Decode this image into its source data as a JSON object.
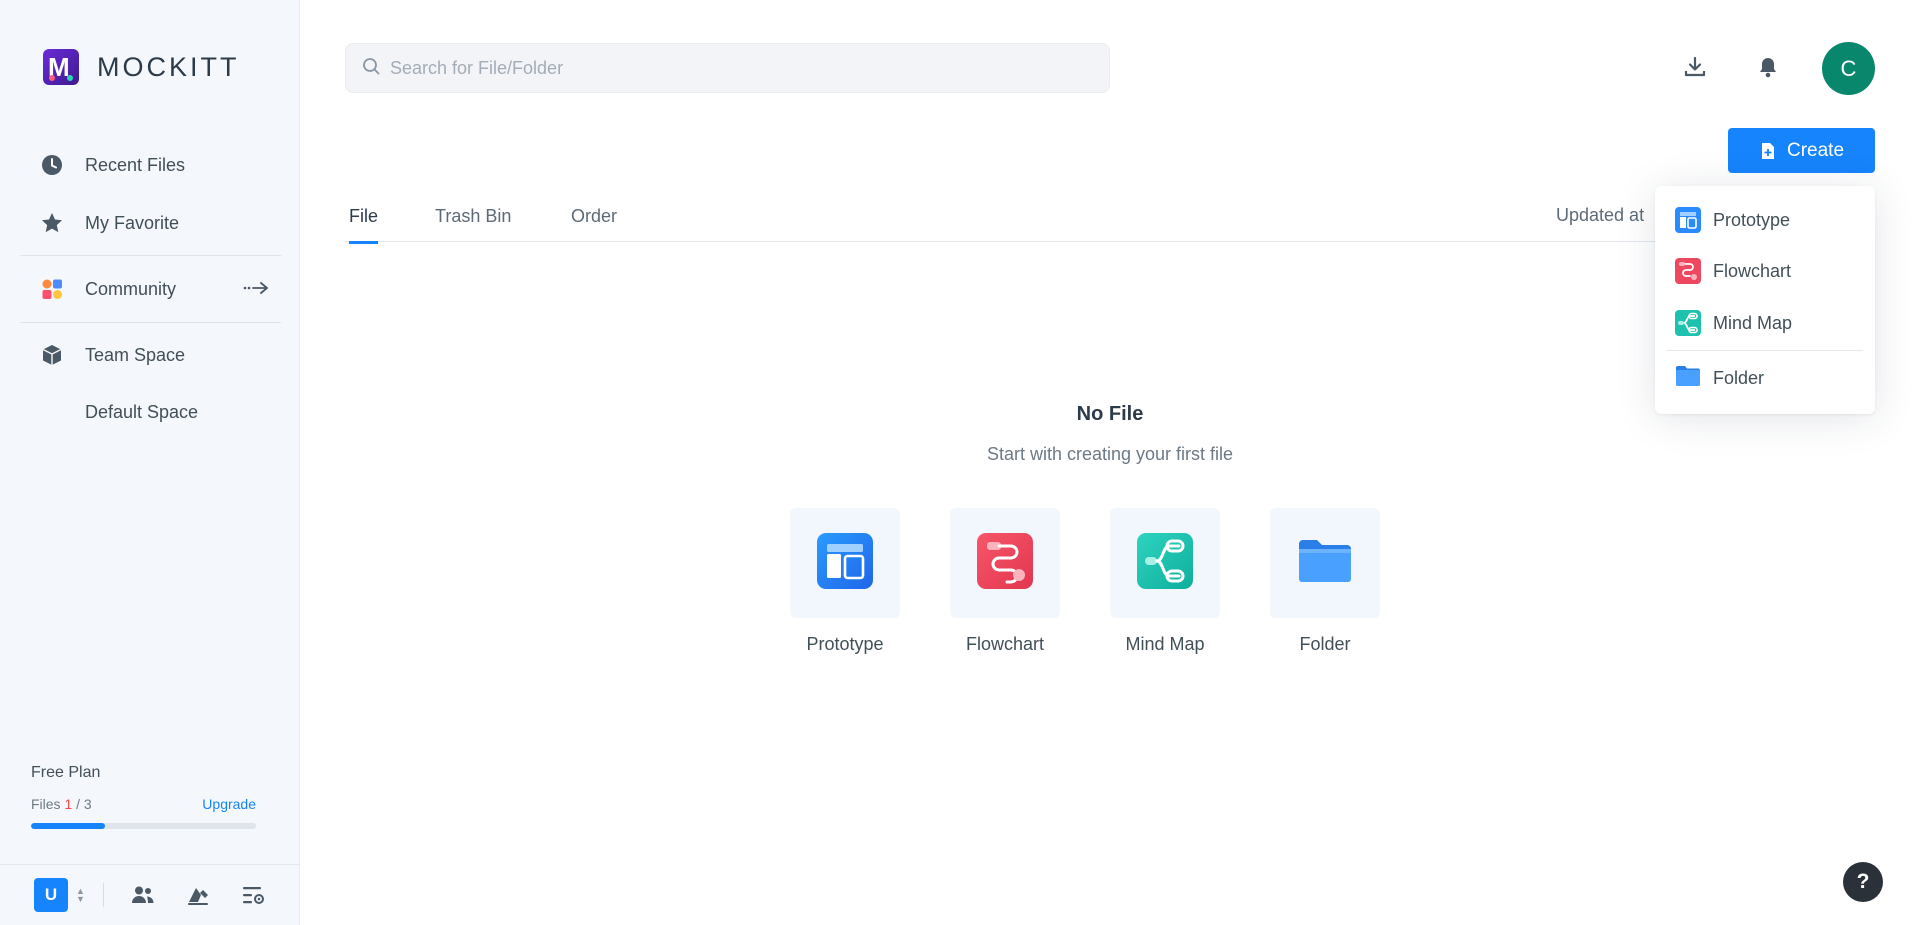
{
  "app": {
    "name": "MOCKITT",
    "logo_letter": "M"
  },
  "sidebar": {
    "items": [
      {
        "label": "Recent Files",
        "icon": "clock-icon"
      },
      {
        "label": "My Favorite",
        "icon": "star-icon"
      },
      {
        "label": "Community",
        "icon": "community-icon"
      },
      {
        "label": "Team Space",
        "icon": "cube-icon"
      },
      {
        "label": "Default Space",
        "icon": ""
      }
    ],
    "plan": {
      "title": "Free Plan",
      "files_label": "Files",
      "files_used": "1",
      "files_sep": "/",
      "files_total": "3",
      "upgrade": "Upgrade",
      "progress": 0.33
    },
    "footer": {
      "team_badge": "U"
    }
  },
  "header": {
    "search_placeholder": "Search for File/Folder",
    "avatar_letter": "C",
    "create_label": "Create"
  },
  "tabs": [
    {
      "label": "File",
      "active": true
    },
    {
      "label": "Trash Bin",
      "active": false
    },
    {
      "label": "Order",
      "active": false
    }
  ],
  "sort_label": "Updated at",
  "empty": {
    "title": "No File",
    "subtitle": "Start with creating your first file",
    "cards": [
      {
        "label": "Prototype",
        "icon": "prototype-icon"
      },
      {
        "label": "Flowchart",
        "icon": "flowchart-icon"
      },
      {
        "label": "Mind Map",
        "icon": "mindmap-icon"
      },
      {
        "label": "Folder",
        "icon": "folder-icon"
      }
    ]
  },
  "dropdown": {
    "items": [
      {
        "label": "Prototype",
        "icon": "prototype-icon"
      },
      {
        "label": "Flowchart",
        "icon": "flowchart-icon"
      },
      {
        "label": "Mind Map",
        "icon": "mindmap-icon"
      },
      {
        "label": "Folder",
        "icon": "folder-icon"
      }
    ]
  },
  "help_label": "?",
  "colors": {
    "accent": "#1684fc",
    "avatar": "#08876c",
    "sidebar_bg": "#f4f7fb"
  }
}
